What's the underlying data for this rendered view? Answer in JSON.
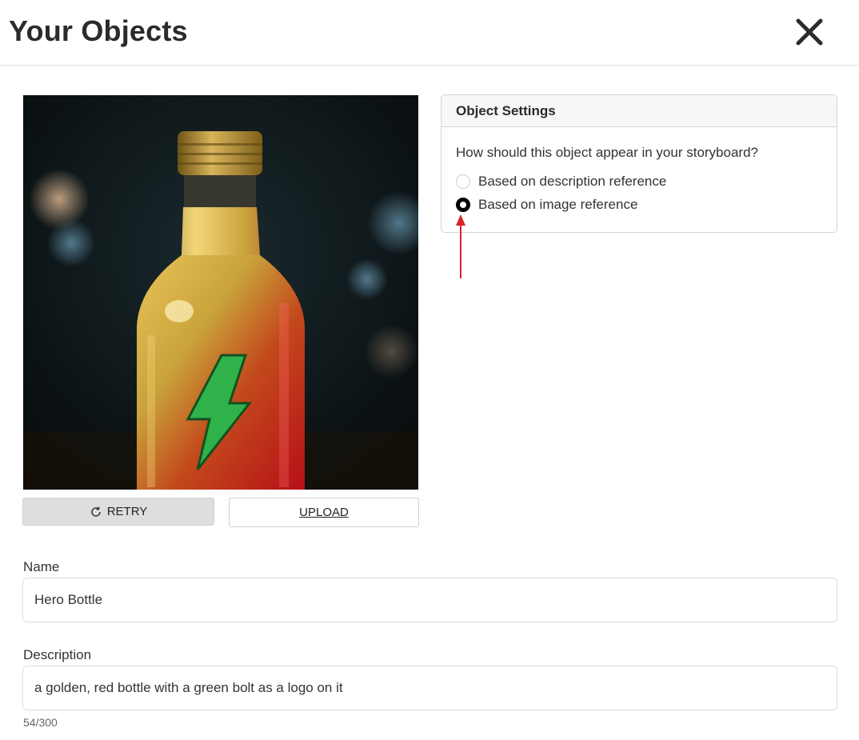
{
  "header": {
    "title": "Your Objects"
  },
  "image": {
    "subject": "golden red bottle with green lightning bolt logo",
    "colors": {
      "gold": "#c9a23a",
      "red": "#c8121a",
      "bolt": "#2fb24a",
      "background": "#0e1416"
    }
  },
  "buttons": {
    "retry_label": "RETRY",
    "upload_label": "UPLOAD"
  },
  "settings": {
    "heading": "Object Settings",
    "question": "How should this object appear in your storyboard?",
    "options": [
      {
        "label": "Based on description reference",
        "selected": false
      },
      {
        "label": "Based on image reference",
        "selected": true
      }
    ]
  },
  "form": {
    "name_label": "Name",
    "name_value": "Hero Bottle",
    "description_label": "Description",
    "description_value": "a golden, red bottle with a green bolt as a logo on it",
    "counter": "54/300"
  },
  "annotation_color": "#d9232b"
}
